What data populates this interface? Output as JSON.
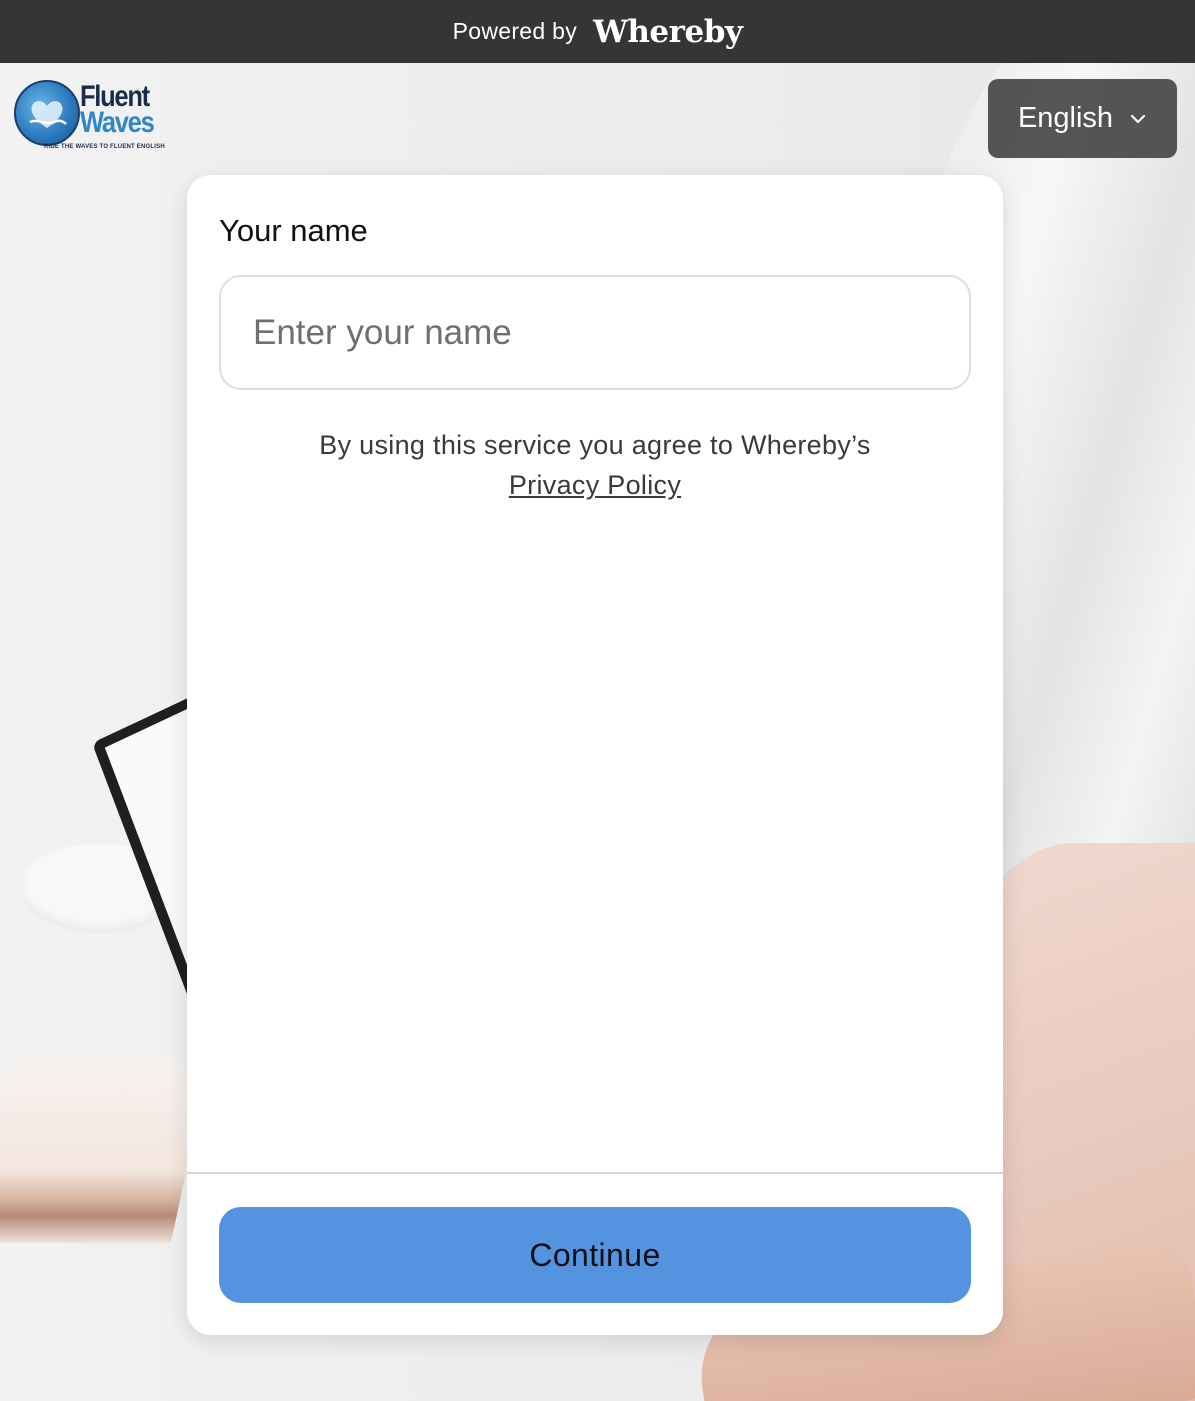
{
  "topbar": {
    "powered_label": "Powered by",
    "brand": "Whereby"
  },
  "logo": {
    "line1": "Fluent",
    "line2": "Waves",
    "tagline": "RIDE THE WAVES TO FLUENT ENGLISH"
  },
  "language": {
    "selected": "English",
    "icon": "chevron-down-icon"
  },
  "form": {
    "name_label": "Your name",
    "name_value": "",
    "name_placeholder": "Enter your name",
    "consent_text": "By using this service you agree to Whereby’s",
    "privacy_link": "Privacy Policy",
    "continue_label": "Continue"
  },
  "colors": {
    "topbar_bg": "#353535",
    "accent": "#5493e0",
    "language_bg": "#484646"
  }
}
